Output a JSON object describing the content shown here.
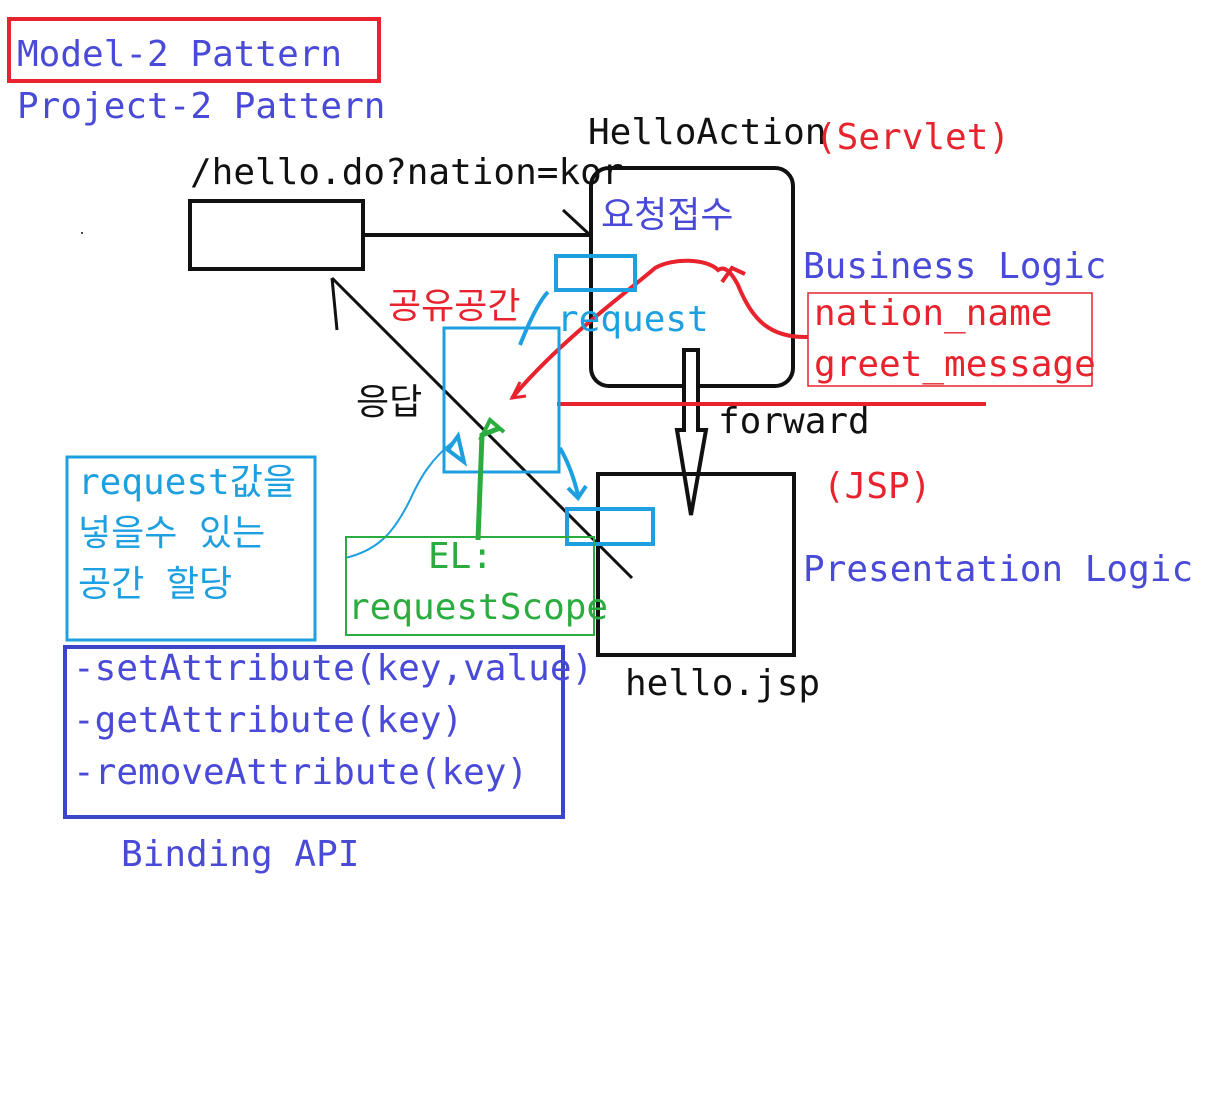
{
  "title": {
    "pattern": "Model-2 Pattern",
    "project": "Project-2 Pattern"
  },
  "servlet": {
    "name": "HelloAction",
    "type": "(Servlet)",
    "receive": "요청접수",
    "logic": "Business Logic"
  },
  "request_url": "/hello.do?nation=kor",
  "response_label": "응답",
  "shared_space": "공유공간",
  "request_label": "request",
  "attributes": [
    "nation_name",
    "greet_message"
  ],
  "forward_label": "forward",
  "jsp": {
    "type": "(JSP)",
    "logic": "Presentation Logic",
    "file": "hello.jsp"
  },
  "request_note": [
    "request값을",
    "넣을수 있는",
    "공간 할당"
  ],
  "el_note": [
    "EL:",
    "requestScope"
  ],
  "binding_methods": [
    "-setAttribute(key,value)",
    "-getAttribute(key)",
    "-removeAttribute(key)"
  ],
  "binding_label": "Binding API",
  "colors": {
    "blue_text": "#4a4ad8",
    "red": "#e8232d",
    "cyan": "#1ea0e0",
    "green": "#2aad3e",
    "black": "#111111"
  }
}
